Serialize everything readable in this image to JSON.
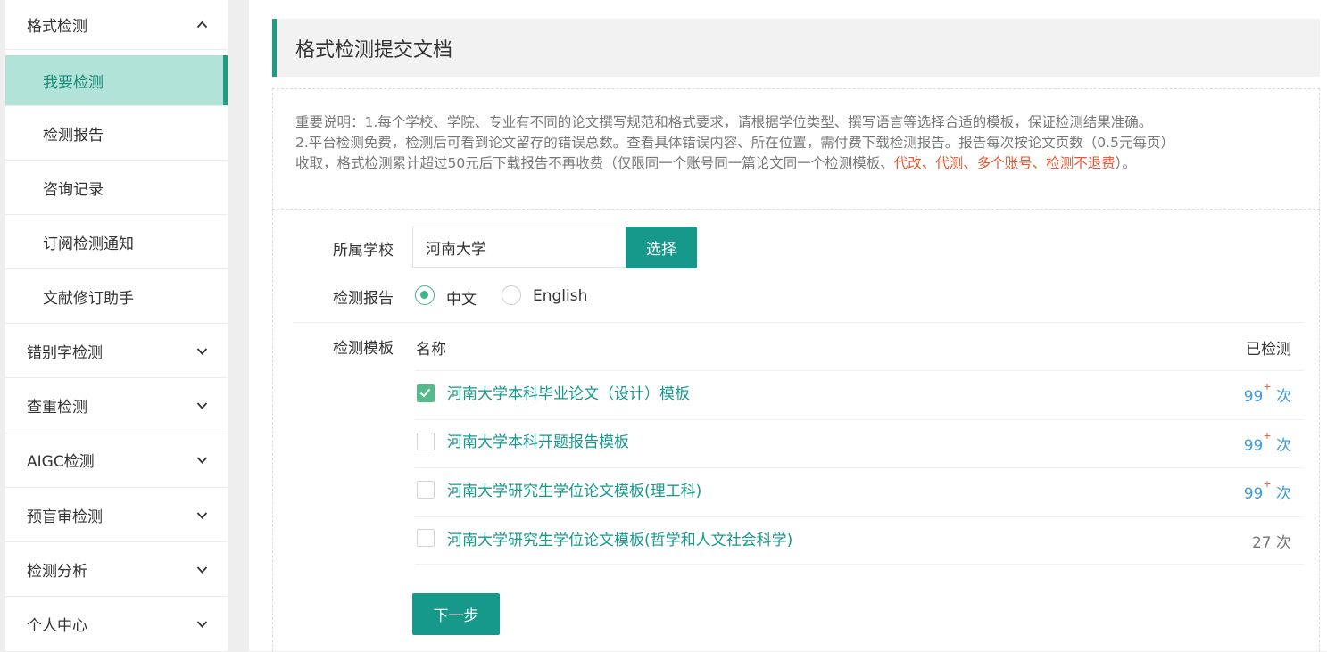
{
  "sidebar": {
    "open_group": "格式检测",
    "sub_items": [
      {
        "label": "我要检测",
        "active": true
      },
      {
        "label": "检测报告",
        "active": false
      },
      {
        "label": "咨询记录",
        "active": false
      },
      {
        "label": "订阅检测通知",
        "active": false
      },
      {
        "label": "文献修订助手",
        "active": false
      }
    ],
    "groups": [
      "错别字检测",
      "查重检测",
      "AIGC检测",
      "预盲审检测",
      "检测分析",
      "个人中心"
    ]
  },
  "page": {
    "title": "格式检测提交文档",
    "notice_line1": "重要说明：1.每个学校、学院、专业有不同的论文撰写规范和格式要求，请根据学位类型、撰写语言等选择合适的模板，保证检测结果准确。",
    "notice_line2": "2.平台检测免费，检测后可看到论文留存的错误总数。查看具体错误内容、所在位置，需付费下载检测报告。报告每次按论文页数（0.5元每页）",
    "notice_line3_prefix": "收取，格式检测累计超过50元后下载报告不再收费（仅限同一个账号同一篇论文同一个检测模板、",
    "notice_line3_warn": "代改、代测、多个账号、检测不退费",
    "notice_line3_suffix": "）。"
  },
  "form": {
    "school_label": "所属学校",
    "school_value": "河南大学",
    "select_button": "选择",
    "report_label": "检测报告",
    "report_options": [
      "中文",
      "English"
    ],
    "report_selected": "中文",
    "template_label": "检测模板",
    "col_name": "名称",
    "col_count": "已检测",
    "templates": [
      {
        "name": "河南大学本科毕业论文（设计）模板",
        "count": "99",
        "sup": "+",
        "unit": "次",
        "checked": true
      },
      {
        "name": "河南大学本科开题报告模板",
        "count": "99",
        "sup": "+",
        "unit": "次",
        "checked": false
      },
      {
        "name": "河南大学研究生学位论文模板(理工科)",
        "count": "99",
        "sup": "+",
        "unit": "次",
        "checked": false
      },
      {
        "name": "河南大学研究生学位论文模板(哲学和人文社会科学)",
        "count": "27",
        "sup": "",
        "unit": "次",
        "checked": false
      }
    ],
    "next_button": "下一步"
  },
  "colors": {
    "accent": "#16998a",
    "active_bg": "#b2e3d8",
    "warn": "#e8562f",
    "count_blue": "#3a9de0"
  }
}
